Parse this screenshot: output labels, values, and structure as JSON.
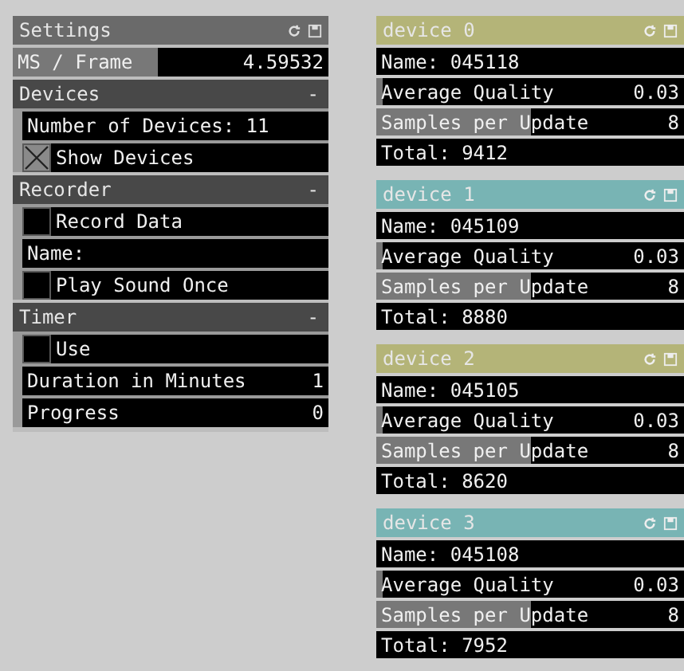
{
  "settings": {
    "title": "Settings",
    "rows": [
      {
        "kind": "slider",
        "label": "MS / Frame",
        "value": "4.59532",
        "level": 0.46
      }
    ],
    "groups": [
      {
        "title": "Devices",
        "toggle": "-",
        "rows": [
          {
            "kind": "label",
            "label": "Number of Devices: 11"
          },
          {
            "kind": "toggle",
            "label": "Show Devices",
            "checked": true
          }
        ]
      },
      {
        "title": "Recorder",
        "toggle": "-",
        "rows": [
          {
            "kind": "toggle",
            "label": "Record Data",
            "checked": false
          },
          {
            "kind": "label",
            "label": "Name:"
          },
          {
            "kind": "toggle",
            "label": "Play Sound Once",
            "checked": false
          }
        ]
      },
      {
        "title": "Timer",
        "toggle": "-",
        "rows": [
          {
            "kind": "toggle",
            "label": "Use",
            "checked": false
          },
          {
            "kind": "value",
            "label": "Duration in Minutes",
            "value": "1"
          },
          {
            "kind": "value",
            "label": "Progress",
            "value": "0"
          }
        ]
      }
    ]
  },
  "devices": [
    {
      "title": "device 0",
      "color": "#b4b478",
      "rows": [
        {
          "kind": "label",
          "label": "Name: 045118"
        },
        {
          "kind": "slider",
          "label": "Average Quality",
          "value": "0.03",
          "level": 0.02
        },
        {
          "kind": "slider",
          "label": "Samples per Update",
          "value": "8",
          "level": 0.5
        },
        {
          "kind": "label",
          "label": "Total: 9412"
        }
      ]
    },
    {
      "title": "device 1",
      "color": "#78b4b4",
      "rows": [
        {
          "kind": "label",
          "label": "Name: 045109"
        },
        {
          "kind": "slider",
          "label": "Average Quality",
          "value": "0.03",
          "level": 0.02
        },
        {
          "kind": "slider",
          "label": "Samples per Update",
          "value": "8",
          "level": 0.5
        },
        {
          "kind": "label",
          "label": "Total: 8880"
        }
      ]
    },
    {
      "title": "device 2",
      "color": "#b4b478",
      "rows": [
        {
          "kind": "label",
          "label": "Name: 045105"
        },
        {
          "kind": "slider",
          "label": "Average Quality",
          "value": "0.03",
          "level": 0.02
        },
        {
          "kind": "slider",
          "label": "Samples per Update",
          "value": "8",
          "level": 0.5
        },
        {
          "kind": "label",
          "label": "Total: 8620"
        }
      ]
    },
    {
      "title": "device 3",
      "color": "#78b4b4",
      "rows": [
        {
          "kind": "label",
          "label": "Name: 045108"
        },
        {
          "kind": "slider",
          "label": "Average Quality",
          "value": "0.03",
          "level": 0.02
        },
        {
          "kind": "slider",
          "label": "Samples per Update",
          "value": "8",
          "level": 0.5
        },
        {
          "kind": "label",
          "label": "Total: 7952"
        }
      ]
    }
  ]
}
